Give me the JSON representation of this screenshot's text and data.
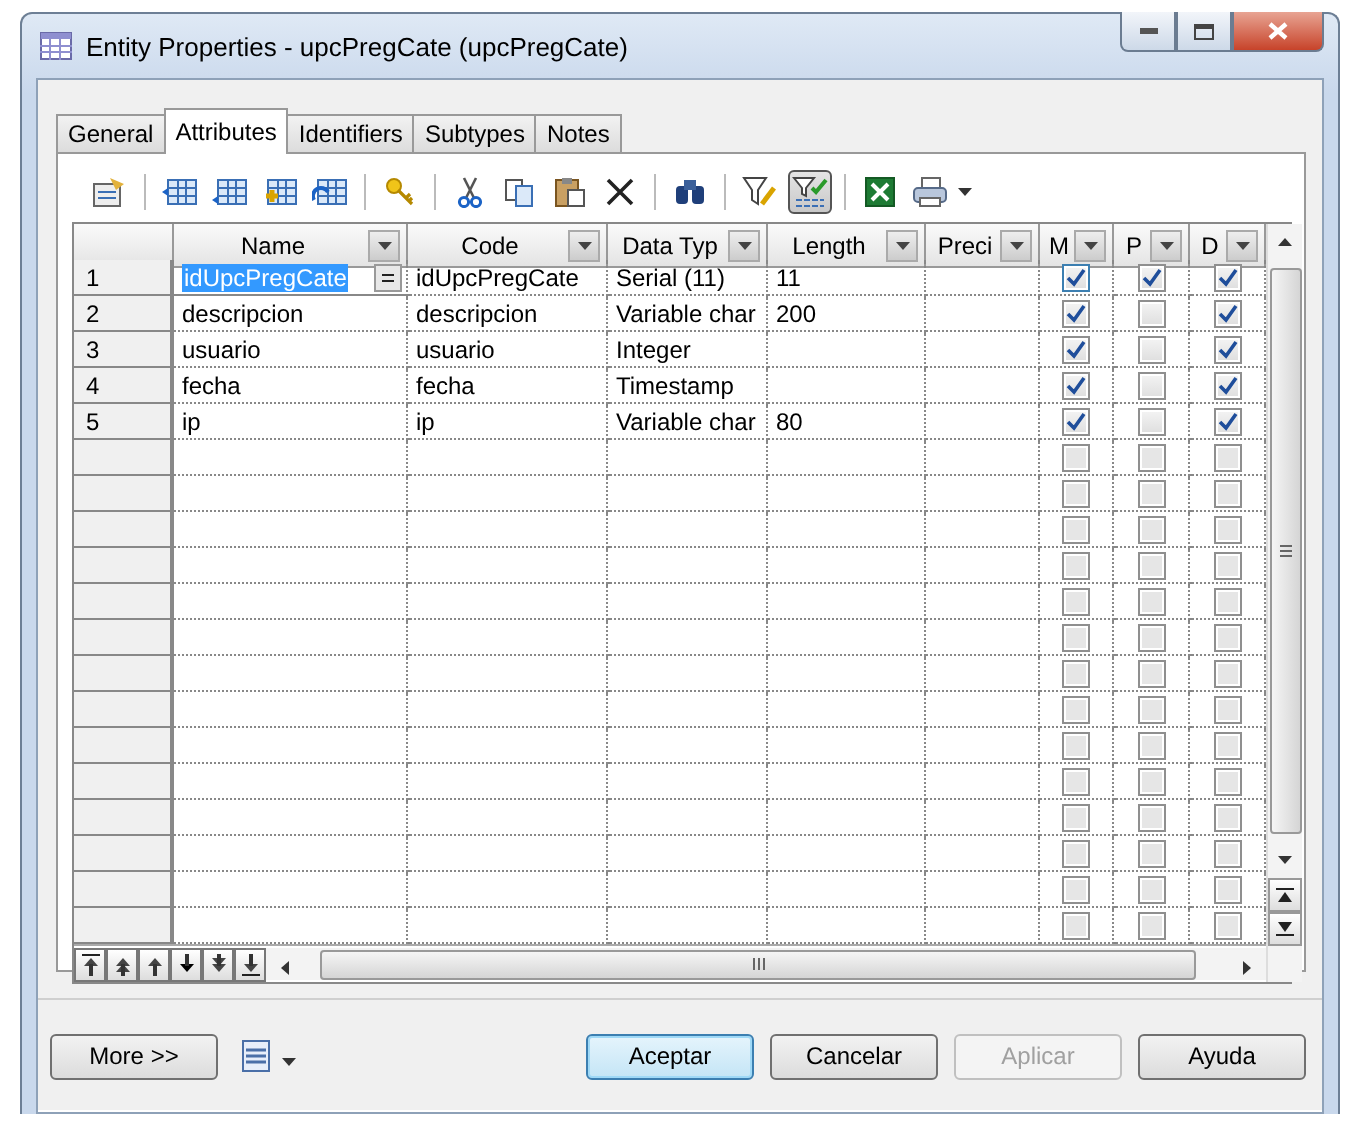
{
  "window": {
    "title": "Entity Properties - upcPregCate (upcPregCate)"
  },
  "tabs": [
    {
      "label": "General",
      "selected": false
    },
    {
      "label": "Attributes",
      "selected": true
    },
    {
      "label": "Identifiers",
      "selected": false
    },
    {
      "label": "Subtypes",
      "selected": false
    },
    {
      "label": "Notes",
      "selected": false
    }
  ],
  "toolbar": {
    "filter_toggle": {
      "on": true
    }
  },
  "table": {
    "columns": [
      "Name",
      "Code",
      "Data Typ",
      "Length",
      "Preci",
      "M",
      "P",
      "D"
    ],
    "rows": [
      {
        "number": "1",
        "name": "idUpcPregCate",
        "code": "idUpcPregCate",
        "data_type": "Serial (11)",
        "length": "11",
        "m": true,
        "p": true,
        "d": true,
        "selected": true
      },
      {
        "number": "2",
        "name": "descripcion",
        "code": "descripcion",
        "data_type": "Variable char",
        "length": "200",
        "m": true,
        "p": false,
        "d": true,
        "selected": false
      },
      {
        "number": "3",
        "name": "usuario",
        "code": "usuario",
        "data_type": "Integer",
        "m": true,
        "p": false,
        "d": true,
        "selected": false
      },
      {
        "number": "4",
        "name": "fecha",
        "code": "fecha",
        "data_type": "Timestamp",
        "m": true,
        "p": false,
        "d": true,
        "selected": false
      },
      {
        "number": "5",
        "name": "ip",
        "code": "ip",
        "data_type": "Variable char",
        "length": "80",
        "m": true,
        "p": false,
        "d": true,
        "selected": false
      }
    ],
    "empty_rows": [
      {
        "m": false,
        "p": false,
        "d": false
      },
      {
        "m": false,
        "p": false,
        "d": false
      },
      {
        "m": false,
        "p": false,
        "d": false
      },
      {
        "m": false,
        "p": false,
        "d": false
      },
      {
        "m": false,
        "p": false,
        "d": false
      },
      {
        "m": false,
        "p": false,
        "d": false
      },
      {
        "m": false,
        "p": false,
        "d": false
      },
      {
        "m": false,
        "p": false,
        "d": false
      },
      {
        "m": false,
        "p": false,
        "d": false
      },
      {
        "m": false,
        "p": false,
        "d": false
      },
      {
        "m": false,
        "p": false,
        "d": false
      },
      {
        "m": false,
        "p": false,
        "d": false
      },
      {
        "m": false,
        "p": false,
        "d": false
      },
      {
        "m": false,
        "p": false,
        "d": false
      }
    ]
  },
  "more_button": "More >>",
  "buttons": [
    {
      "label": "Aceptar",
      "default": true,
      "disabled": false
    },
    {
      "label": "Cancelar",
      "default": false,
      "disabled": false
    },
    {
      "label": "Aplicar",
      "default": false,
      "disabled": true
    },
    {
      "label": "Ayuda",
      "default": false,
      "disabled": false
    }
  ]
}
